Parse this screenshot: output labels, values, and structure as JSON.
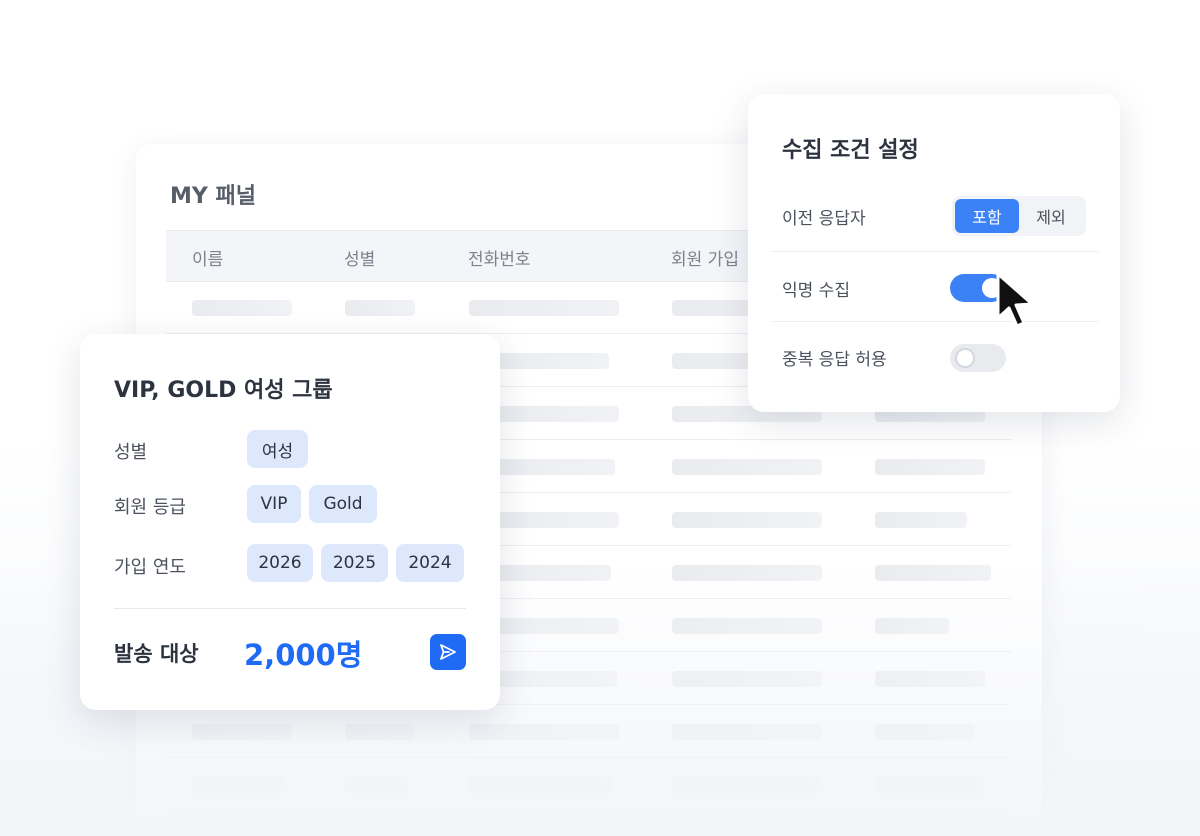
{
  "panel": {
    "title": "MY 패널",
    "columns": [
      "이름",
      "성별",
      "전화번호",
      "회원 가입"
    ]
  },
  "settings": {
    "title": "수집 조건 설정",
    "rows": {
      "previous_respondents": {
        "label": "이전 응답자",
        "options": [
          "포함",
          "제외"
        ],
        "selected": "포함"
      },
      "anonymous": {
        "label": "익명 수집",
        "enabled": true
      },
      "duplicate": {
        "label": "중복 응답 허용",
        "enabled": false
      }
    }
  },
  "group": {
    "title": "VIP, GOLD 여성 그룹",
    "filters": {
      "gender": {
        "label": "성별",
        "values": [
          "여성"
        ]
      },
      "grade": {
        "label": "회원 등급",
        "values": [
          "VIP",
          "Gold"
        ]
      },
      "year": {
        "label": "가입 연도",
        "values": [
          "2026",
          "2025",
          "2024"
        ]
      }
    },
    "target_label": "발송 대상",
    "target_count": "2,000명"
  },
  "colors": {
    "accent": "#1f6bf5",
    "toggle_on": "#3b82f6",
    "chip_bg": "#dde8fc"
  },
  "icons": {
    "send": "send-icon",
    "cursor": "cursor-icon"
  }
}
